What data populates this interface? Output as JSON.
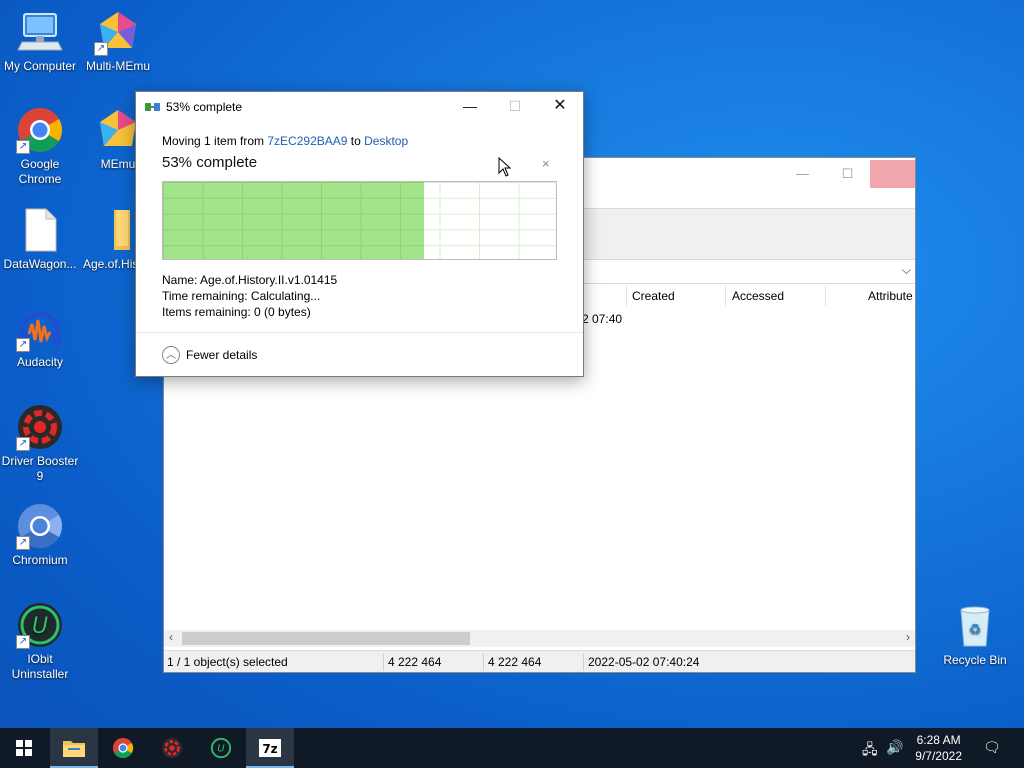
{
  "desktop": {
    "icons": [
      {
        "label": "My Computer"
      },
      {
        "label": "Multi-MEmu"
      },
      {
        "label": "Google Chrome"
      },
      {
        "label": "MEmu"
      },
      {
        "label": "DataWagon..."
      },
      {
        "label": "Age.of.His"
      },
      {
        "label": "Audacity"
      },
      {
        "label": "Driver Booster 9"
      },
      {
        "label": "Chromium"
      },
      {
        "label": "IObit Uninstaller"
      },
      {
        "label": "Recycle Bin"
      }
    ]
  },
  "zip_window": {
    "columns": [
      "Created",
      "Accessed",
      "Attribute"
    ],
    "row_created_partial": "2 07:40",
    "status": {
      "selected": "1 / 1 object(s) selected",
      "size": "4 222 464",
      "packed": "4 222 464",
      "modified": "2022-05-02 07:40:24"
    }
  },
  "dialog": {
    "title": "53% complete",
    "moving_prefix": "Moving 1 item from ",
    "source": "7zEC292BAA9",
    "moving_mid": " to ",
    "destination": "Desktop",
    "percent_label": "53% complete",
    "progress": 0.665,
    "name_line": "Name:  Age.of.History.II.v1.01415",
    "time_line": "Time remaining:  Calculating...",
    "items_line": "Items remaining:  0 (0 bytes)",
    "fewer_details": "Fewer details",
    "close_small": "×"
  },
  "taskbar": {
    "time": "6:28 AM",
    "date": "9/7/2022"
  },
  "colors": {
    "progress_fill": "#a3e38a",
    "link": "#1e5fb3",
    "taskbar": "#101a26"
  }
}
